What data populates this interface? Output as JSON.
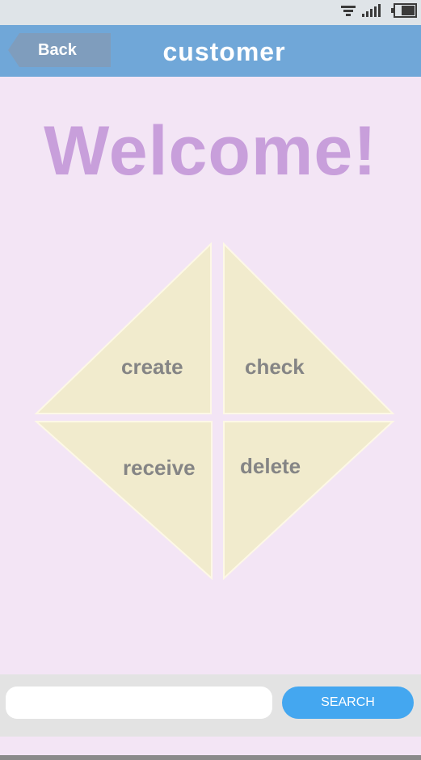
{
  "app_bar": {
    "back_label": "Back",
    "title": "customer",
    "color": "#70a7d8"
  },
  "status_bar": {
    "icons": [
      "wifi-icon",
      "signal-icon",
      "battery-icon"
    ]
  },
  "main": {
    "welcome": "Welcome!",
    "menu": {
      "create": "create",
      "check": "check",
      "receive": "receive",
      "delete": "delete"
    }
  },
  "search": {
    "value": "",
    "placeholder": "",
    "button_label": "SEARCH"
  },
  "colors": {
    "background": "#f3e5f5",
    "welcome_text": "#c89fdb",
    "triangle_fill": "#f1ebcd",
    "search_button": "#44a7f0"
  }
}
